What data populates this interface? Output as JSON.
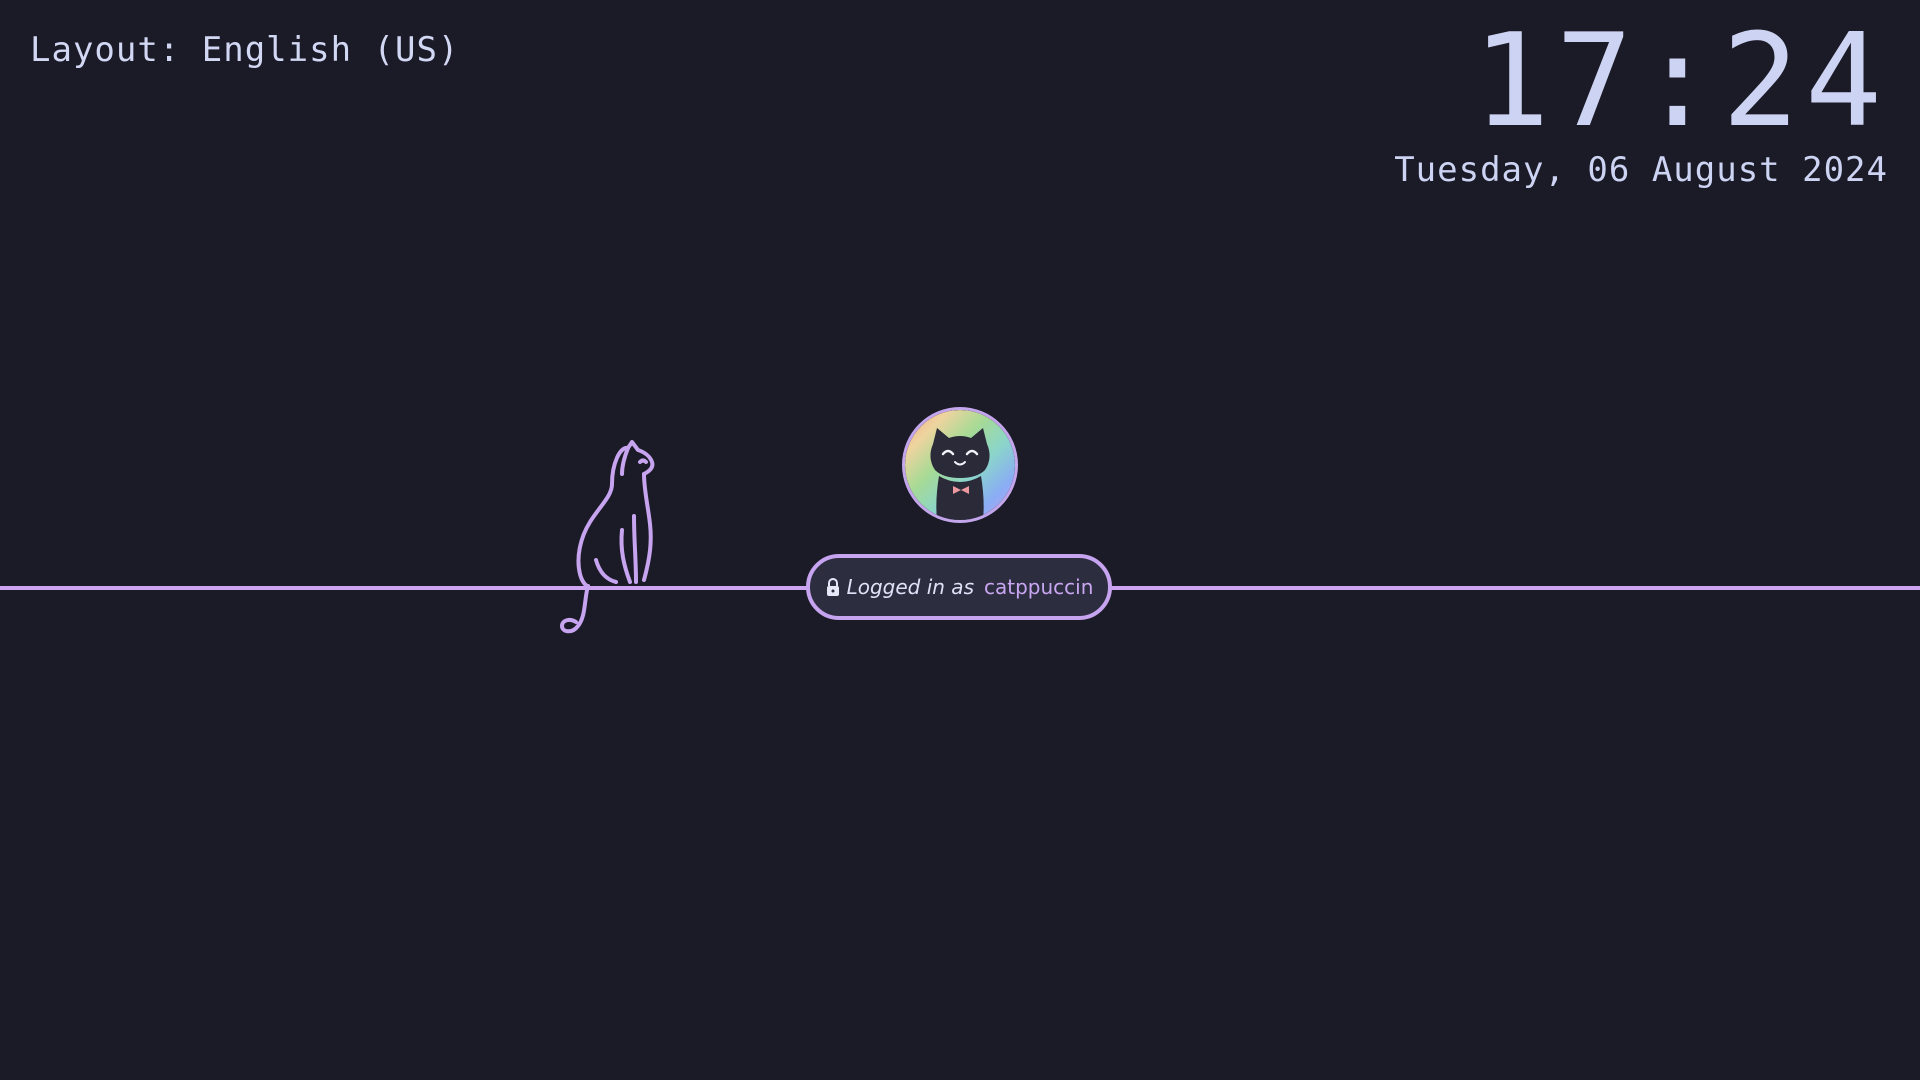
{
  "keyboard": {
    "layout_text": "Layout: English (US)"
  },
  "clock": {
    "time": "17:24",
    "date": "Tuesday, 06 August 2024"
  },
  "user": {
    "login_prefix": "Logged in as",
    "username": "catppuccin",
    "avatar_icon": "smiling-black-cat-avatar"
  },
  "decor": {
    "cat_icon": "cat-outline-icon",
    "lock_icon": "lock-icon"
  },
  "colors": {
    "background": "#1b1b27",
    "accent": "#cba6f7",
    "text": "#cdd6f4",
    "pill_background": "#2d2d40"
  }
}
